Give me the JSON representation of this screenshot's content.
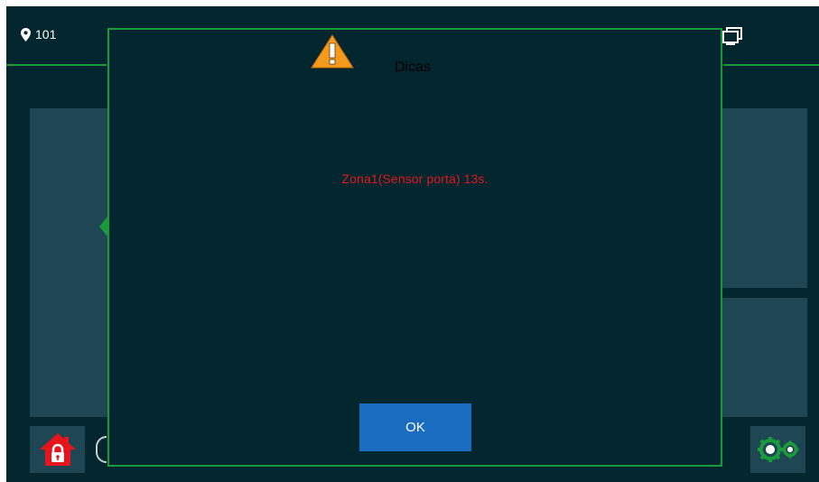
{
  "header": {
    "location_label": "101"
  },
  "dialog": {
    "title": "Dicas",
    "message": "Zona1(Sensor porta)  13s.",
    "ok_label": "OK"
  },
  "colors": {
    "background": "#04262f",
    "panel": "#1f4653",
    "accent_line": "#1a9a3a",
    "message_text": "#e0181c",
    "ok_button": "#1a6cc0",
    "home_icon": "#e8141b"
  },
  "icons": [
    "location-pin-icon",
    "devices-icon",
    "warning-icon",
    "home-lock-icon",
    "gears-icon",
    "left-arrow-icon"
  ]
}
